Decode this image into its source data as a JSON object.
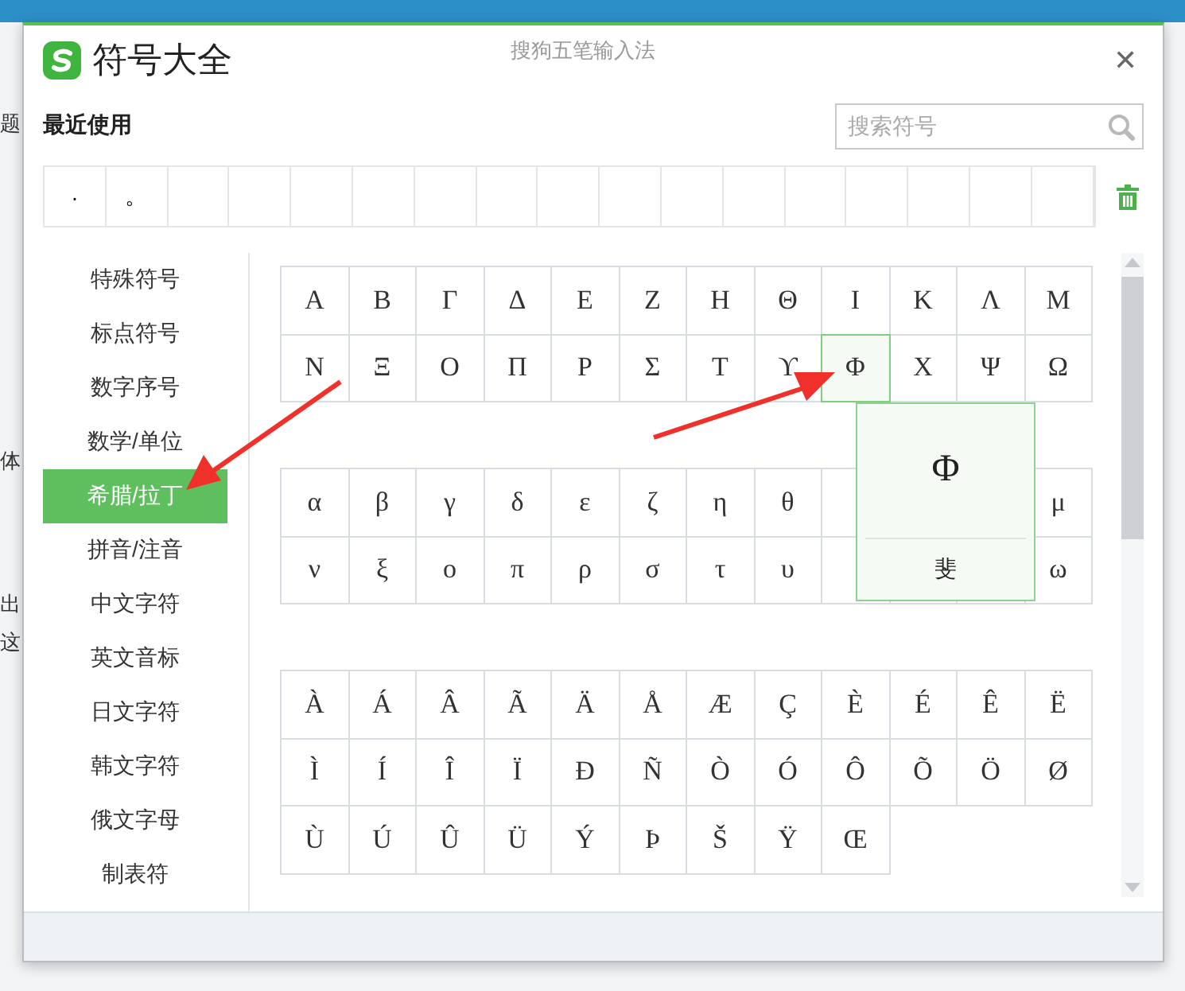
{
  "background_app": {
    "fragments": [
      "题",
      "体",
      "出",
      "这"
    ]
  },
  "window": {
    "title": "符号大全",
    "subtitle": "搜狗五笔输入法",
    "close": "✕"
  },
  "recent": {
    "label": "最近使用",
    "symbols": [
      "·",
      "。"
    ]
  },
  "search": {
    "placeholder": "搜索符号"
  },
  "sidebar": {
    "items": [
      {
        "label": "特殊符号",
        "selected": false
      },
      {
        "label": "标点符号",
        "selected": false
      },
      {
        "label": "数字序号",
        "selected": false
      },
      {
        "label": "数学/单位",
        "selected": false
      },
      {
        "label": "希腊/拉丁",
        "selected": true
      },
      {
        "label": "拼音/注音",
        "selected": false
      },
      {
        "label": "中文字符",
        "selected": false
      },
      {
        "label": "英文音标",
        "selected": false
      },
      {
        "label": "日文字符",
        "selected": false
      },
      {
        "label": "韩文字符",
        "selected": false
      },
      {
        "label": "俄文字母",
        "selected": false
      },
      {
        "label": "制表符",
        "selected": false
      }
    ]
  },
  "sections": [
    {
      "rows": [
        [
          {
            "symbol": "Α",
            "hovered": false
          },
          {
            "symbol": "Β",
            "hovered": false
          },
          {
            "symbol": "Γ",
            "hovered": false
          },
          {
            "symbol": "Δ",
            "hovered": false
          },
          {
            "symbol": "Ε",
            "hovered": false
          },
          {
            "symbol": "Ζ",
            "hovered": false
          },
          {
            "symbol": "Η",
            "hovered": false
          },
          {
            "symbol": "Θ",
            "hovered": false
          },
          {
            "symbol": "Ι",
            "hovered": false
          },
          {
            "symbol": "Κ",
            "hovered": false
          },
          {
            "symbol": "Λ",
            "hovered": false
          },
          {
            "symbol": "Μ",
            "hovered": false
          }
        ],
        [
          {
            "symbol": "Ν",
            "hovered": false
          },
          {
            "symbol": "Ξ",
            "hovered": false
          },
          {
            "symbol": "Ο",
            "hovered": false
          },
          {
            "symbol": "Π",
            "hovered": false
          },
          {
            "symbol": "Ρ",
            "hovered": false
          },
          {
            "symbol": "Σ",
            "hovered": false
          },
          {
            "symbol": "Τ",
            "hovered": false
          },
          {
            "symbol": "ϒ",
            "hovered": false
          },
          {
            "symbol": "Φ",
            "hovered": true
          },
          {
            "symbol": "Χ",
            "hovered": false
          },
          {
            "symbol": "Ψ",
            "hovered": false
          },
          {
            "symbol": "Ω",
            "hovered": false
          }
        ]
      ]
    },
    {
      "rows": [
        [
          {
            "symbol": "α",
            "hovered": false
          },
          {
            "symbol": "β",
            "hovered": false
          },
          {
            "symbol": "γ",
            "hovered": false
          },
          {
            "symbol": "δ",
            "hovered": false
          },
          {
            "symbol": "ε",
            "hovered": false
          },
          {
            "symbol": "ζ",
            "hovered": false
          },
          {
            "symbol": "η",
            "hovered": false
          },
          {
            "symbol": "θ",
            "hovered": false
          },
          null,
          null,
          null,
          {
            "symbol": "μ",
            "hovered": false
          }
        ],
        [
          {
            "symbol": "ν",
            "hovered": false
          },
          {
            "symbol": "ξ",
            "hovered": false
          },
          {
            "symbol": "ο",
            "hovered": false
          },
          {
            "symbol": "π",
            "hovered": false
          },
          {
            "symbol": "ρ",
            "hovered": false
          },
          {
            "symbol": "σ",
            "hovered": false
          },
          {
            "symbol": "τ",
            "hovered": false
          },
          {
            "symbol": "υ",
            "hovered": false
          },
          null,
          null,
          null,
          {
            "symbol": "ω",
            "hovered": false
          }
        ]
      ]
    },
    {
      "rows": [
        [
          {
            "symbol": "À",
            "hovered": false
          },
          {
            "symbol": "Á",
            "hovered": false
          },
          {
            "symbol": "Â",
            "hovered": false
          },
          {
            "symbol": "Ã",
            "hovered": false
          },
          {
            "symbol": "Ä",
            "hovered": false
          },
          {
            "symbol": "Å",
            "hovered": false
          },
          {
            "symbol": "Æ",
            "hovered": false
          },
          {
            "symbol": "Ç",
            "hovered": false
          },
          {
            "symbol": "È",
            "hovered": false
          },
          {
            "symbol": "É",
            "hovered": false
          },
          {
            "symbol": "Ê",
            "hovered": false
          },
          {
            "symbol": "Ë",
            "hovered": false
          }
        ],
        [
          {
            "symbol": "Ì",
            "hovered": false
          },
          {
            "symbol": "Í",
            "hovered": false
          },
          {
            "symbol": "Î",
            "hovered": false
          },
          {
            "symbol": "Ï",
            "hovered": false
          },
          {
            "symbol": "Ð",
            "hovered": false
          },
          {
            "symbol": "Ñ",
            "hovered": false
          },
          {
            "symbol": "Ò",
            "hovered": false
          },
          {
            "symbol": "Ó",
            "hovered": false
          },
          {
            "symbol": "Ô",
            "hovered": false
          },
          {
            "symbol": "Õ",
            "hovered": false
          },
          {
            "symbol": "Ö",
            "hovered": false
          },
          {
            "symbol": "Ø",
            "hovered": false
          }
        ],
        [
          {
            "symbol": "Ù",
            "hovered": false
          },
          {
            "symbol": "Ú",
            "hovered": false
          },
          {
            "symbol": "Û",
            "hovered": false
          },
          {
            "symbol": "Ü",
            "hovered": false
          },
          {
            "symbol": "Ý",
            "hovered": false
          },
          {
            "symbol": "Þ",
            "hovered": false
          },
          {
            "symbol": "Š",
            "hovered": false
          },
          {
            "symbol": "Ÿ",
            "hovered": false
          },
          {
            "symbol": "Œ",
            "hovered": false
          }
        ]
      ]
    }
  ],
  "preview": {
    "symbol": "Φ",
    "name": "斐"
  }
}
